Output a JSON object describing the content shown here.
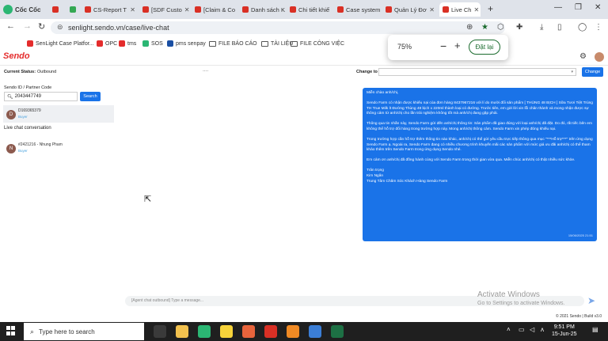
{
  "browser": {
    "brand": "Cốc Cốc",
    "tabs": [
      {
        "title": "",
        "favicon_color": "#d93025"
      },
      {
        "title": "",
        "favicon_color": "#34a853"
      },
      {
        "title": "CS-Report T",
        "favicon_color": "#d93025"
      },
      {
        "title": "[SDF Custo",
        "favicon_color": "#d93025"
      },
      {
        "title": "[Claim & Co",
        "favicon_color": "#d93025"
      },
      {
        "title": "Danh sách K",
        "favicon_color": "#d93025"
      },
      {
        "title": "Chi tiết khiế",
        "favicon_color": "#d93025"
      },
      {
        "title": "Case system",
        "favicon_color": "#d93025"
      },
      {
        "title": "Quản Lý Đơ",
        "favicon_color": "#d93025"
      },
      {
        "title": "Live Ch",
        "favicon_color": "#d93025"
      }
    ],
    "new_tab": "+",
    "url": "senlight.sendo.vn/case/live-chat",
    "bookmarks": [
      {
        "label": "SenLight Case Platfor...",
        "icon": "sendo",
        "color": "#e42c2c"
      },
      {
        "label": "OPC",
        "icon": "sendo",
        "color": "#e42c2c"
      },
      {
        "label": "tms",
        "icon": "sendo",
        "color": "#e42c2c"
      },
      {
        "label": "SOS",
        "icon": "sos",
        "color": "#2bb673"
      },
      {
        "label": "pms senpay",
        "icon": "pms",
        "color": "#1a4fa3"
      },
      {
        "label": "FILE BÁO CÁO",
        "icon": "folder"
      },
      {
        "label": "TÀI LIỆU",
        "icon": "folder"
      },
      {
        "label": "FILE CÔNG VIỆC",
        "icon": "folder"
      }
    ]
  },
  "zoom": {
    "level": "75%",
    "minus": "−",
    "plus": "+",
    "reset": "Đặt lại"
  },
  "app": {
    "logo": "Sendo"
  },
  "status": {
    "current_label": "Current Status:",
    "current_value": "Outbound",
    "ellipsis": "····",
    "change_label": "Change to",
    "change_button": "Change"
  },
  "left": {
    "search_label": "Sendo ID / Partner Code",
    "search_value": "2043447749",
    "search_button": "Search",
    "contact_result": {
      "initial": "D",
      "name": "D169365379",
      "sub": "Buyer"
    },
    "conversation_heading": "Live chat conversation",
    "conversations": [
      {
        "initial": "N",
        "name": "#2421216 - Nhung Pham",
        "sub": "Buyer"
      }
    ]
  },
  "chat": {
    "paragraphs": [
      "Miễn chào anh/chị,",
      "Sendo Farm có nhận được khiếu nại của đơn hàng 8437967216 với lí do mười đổi sản phẩm [ THÙNG 48 BỊCH ] Sữa Tươi Tiệt Trùng TH True Milk Ít Đường Thùng 48 bịch x 220ml thành loại có đường. Trước tiên, em gửi lời xin lỗi chân thành và mong nhận được sự thông cảm từ anh/chị cho lần trải nghiệm không tốt mà anh/chị đang gặp phải.",
      "Thông qua tin nhắn này, Sendo Farm gửi đến anh/chị thông tin: Sản phẩm đã giao đúng với loại anh/chị đã đặt. Do đó, rất tiếc bên em không thể hỗ trợ đổi hàng trong trường hợp này. Mong anh/chị thông cảm. Sendo Farm xin phép đóng khiếu nại.",
      "Trong trường hợp cần hỗ trợ thêm thông tin nào khác, anh/chị có thể gửi yêu cầu trực tiếp thông qua mục \"***Hỗ trợ***\" trên ứng dụng Sendo Farm ạ. Ngoài ra, Sendo Farm đang có nhiều chương trình khuyến mãi các sản phẩm với mức giá ưu đãi anh/chị có thể tham khảo thêm trên Sendo Farm trong ứng dụng Sendo nhé.",
      "Em cảm ơn anh/chị đã đồng hành cùng với Sendo Farm trong thời gian vừa qua. Miễn chúc anh/chị có thật nhiều sức khỏe.",
      "Trân trọng\nKim Ngân\nTrung Tâm Chăm Sóc Khách Hàng Sendo Farm"
    ],
    "timestamp": "15/06/2025 21:51",
    "input_placeholder": "[Agent chat outbound] Type a message...",
    "watermark_title": "Activate Windows",
    "watermark_sub": "Go to Settings to activate Windows.",
    "footer": "© 2021 Sendo | Build v3.0"
  },
  "taskbar": {
    "search_placeholder": "Type here to search",
    "time": "9:51 PM",
    "date": "15-Jun-25",
    "apps": [
      {
        "name": "task-view",
        "color": "#3a3a3a"
      },
      {
        "name": "file-explorer",
        "color": "#f2c14e"
      },
      {
        "name": "coccoc",
        "color": "#2bb673"
      },
      {
        "name": "sticky-notes",
        "color": "#f7d33a"
      },
      {
        "name": "browser-2",
        "color": "#e8643c"
      },
      {
        "name": "app-red",
        "color": "#d93025"
      },
      {
        "name": "app-orange",
        "color": "#f08a24"
      },
      {
        "name": "app-blue",
        "color": "#3b7ed6"
      },
      {
        "name": "excel",
        "color": "#1d7044"
      }
    ]
  }
}
